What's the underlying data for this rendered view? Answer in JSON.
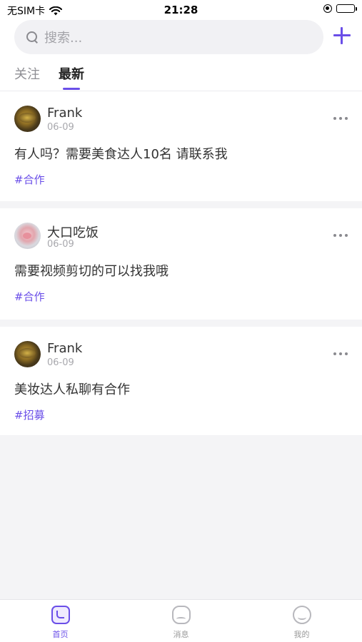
{
  "status_bar": {
    "carrier": "无SIM卡",
    "time": "21:28"
  },
  "search": {
    "placeholder": "搜索..."
  },
  "tabs": [
    {
      "label": "关注",
      "active": false
    },
    {
      "label": "最新",
      "active": true
    }
  ],
  "posts": [
    {
      "author": "Frank",
      "date": "06-09",
      "content": "有人吗？需要美食达人10名 请联系我",
      "tag": "#合作",
      "avatar": "food-avatar"
    },
    {
      "author": "大口吃饭",
      "date": "06-09",
      "content": "需要视频剪切的可以找我哦",
      "tag": "#合作",
      "avatar": "pig-avatar"
    },
    {
      "author": "Frank",
      "date": "06-09",
      "content": "美妆达人私聊有合作",
      "tag": "#招募",
      "avatar": "food-avatar"
    }
  ],
  "tab_bar": [
    {
      "label": "首页",
      "icon": "home-icon",
      "active": true
    },
    {
      "label": "消息",
      "icon": "message-icon",
      "active": false
    },
    {
      "label": "我的",
      "icon": "profile-icon",
      "active": false
    }
  ],
  "colors": {
    "accent": "#6a4ee8",
    "background": "#f4f4f6"
  }
}
